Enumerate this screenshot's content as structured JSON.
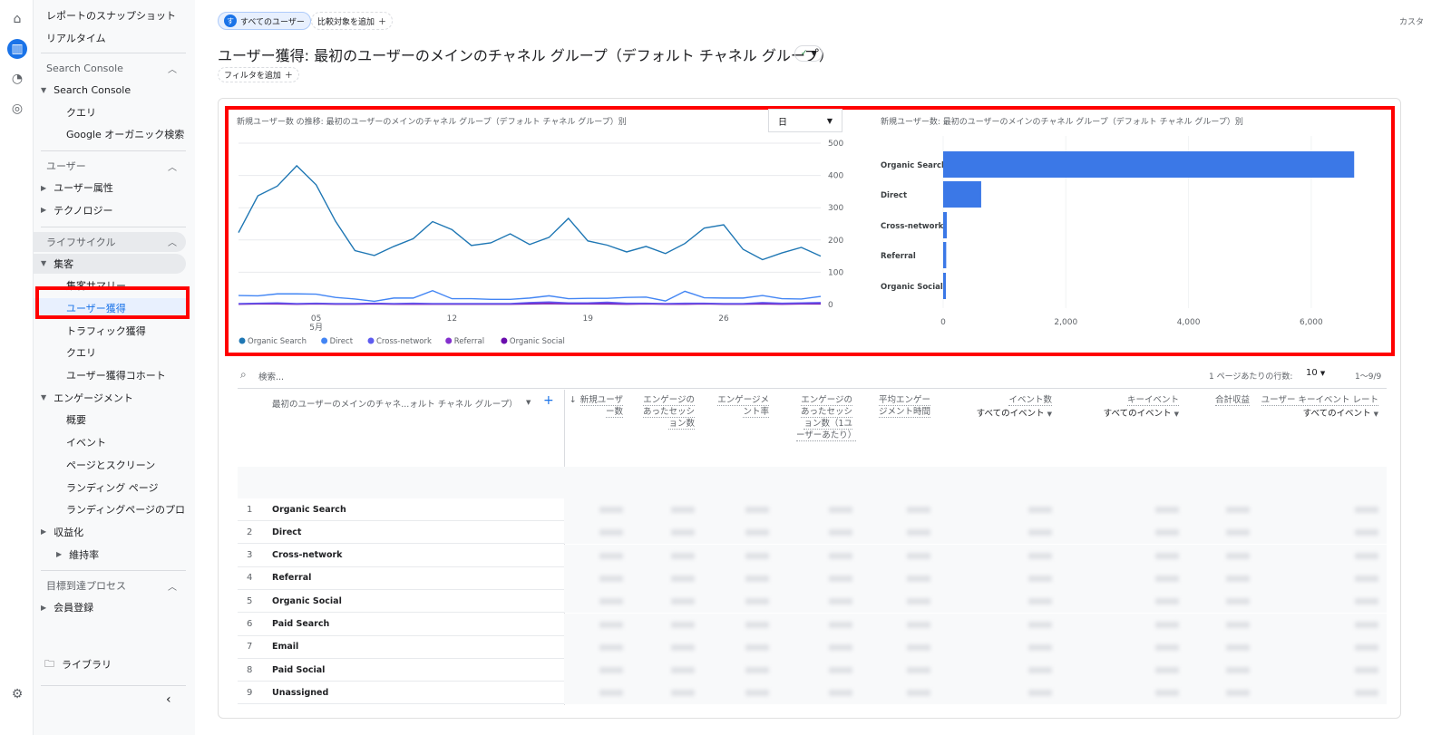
{
  "rail": {
    "icons": [
      "home-icon",
      "reports-icon",
      "explore-icon",
      "advertising-icon",
      "gear-icon"
    ]
  },
  "sidebar": {
    "top": [
      "レポートのスナップショット",
      "リアルタイム"
    ],
    "sections": [
      {
        "title": "Search Console",
        "items": [
          {
            "label": "Search Console",
            "expanded": true
          },
          {
            "label": "クエリ"
          },
          {
            "label": "Google オーガニック検索レ..."
          }
        ]
      },
      {
        "title": "ユーザー",
        "items": [
          {
            "label": "ユーザー属性"
          },
          {
            "label": "テクノロジー"
          }
        ]
      },
      {
        "title": "ライフサイクル",
        "items": [
          {
            "label": "集客",
            "expanded": true
          },
          {
            "label": "集客サマリー"
          },
          {
            "label": "ユーザー獲得",
            "selected": true
          },
          {
            "label": "トラフィック獲得"
          },
          {
            "label": "クエリ"
          },
          {
            "label": "ユーザー獲得コホート"
          },
          {
            "label": "エンゲージメント",
            "expanded": true
          },
          {
            "label": "概要"
          },
          {
            "label": "イベント"
          },
          {
            "label": "ページとスクリーン"
          },
          {
            "label": "ランディング ページ"
          },
          {
            "label": "ランディングページのプロ..."
          },
          {
            "label": "収益化"
          },
          {
            "label": "維持率"
          }
        ]
      },
      {
        "title": "目標到達プロセス",
        "items": [
          {
            "label": "会員登録"
          }
        ]
      }
    ],
    "library": "ライブラリ"
  },
  "header": {
    "segment_avatar": "す",
    "segment": "すべてのユーザー",
    "add_comparison": "比較対象を追加",
    "title": "ユーザー獲得: 最初のユーザーのメインのチャネル グループ（デフォルト チャネル グループ）",
    "add_filter": "フィルタを追加",
    "customize": "カスタ"
  },
  "colors": {
    "accent": "#1a73e8",
    "highlight": "#ff0000"
  },
  "chart_data": [
    {
      "type": "line",
      "title": "新規ユーザー数 の推移: 最初のユーザーのメインのチャネル グループ（デフォルト チャネル グループ）別",
      "granularity": "日",
      "x_ticks": [
        "05",
        "12",
        "19",
        "26"
      ],
      "x_month": "5月",
      "y_ticks": [
        0,
        100,
        200,
        300,
        400,
        500
      ],
      "ylim": [
        0,
        500
      ],
      "grid": true,
      "legend": "bottom-left",
      "x": [
        "5/1",
        "5/2",
        "5/3",
        "5/4",
        "5/5",
        "5/6",
        "5/7",
        "5/8",
        "5/9",
        "5/10",
        "5/11",
        "5/12",
        "5/13",
        "5/14",
        "5/15",
        "5/16",
        "5/17",
        "5/18",
        "5/19",
        "5/20",
        "5/21",
        "5/22",
        "5/23",
        "5/24",
        "5/25",
        "5/26",
        "5/27",
        "5/28",
        "5/29",
        "5/30",
        "5/31"
      ],
      "series": [
        {
          "name": "Organic Search",
          "color": "#1f77b4",
          "values": [
            223,
            337,
            367,
            430,
            371,
            258,
            167,
            152,
            180,
            204,
            257,
            232,
            183,
            191,
            219,
            186,
            208,
            267,
            197,
            184,
            163,
            180,
            158,
            189,
            237,
            247,
            171,
            139,
            160,
            177,
            150
          ]
        },
        {
          "name": "Direct",
          "color": "#4285f4",
          "values": [
            28,
            27,
            33,
            33,
            32,
            22,
            17,
            10,
            20,
            20,
            43,
            18,
            18,
            16,
            16,
            20,
            27,
            18,
            19,
            19,
            22,
            23,
            11,
            41,
            21,
            20,
            20,
            28,
            18,
            17,
            25
          ]
        },
        {
          "name": "Cross-network",
          "color": "#5e5cf0",
          "values": [
            3,
            4,
            5,
            3,
            4,
            3,
            3,
            4,
            3,
            4,
            3,
            3,
            3,
            3,
            3,
            6,
            8,
            5,
            5,
            7,
            4,
            4,
            3,
            4,
            4,
            3,
            3,
            6,
            4,
            5,
            6
          ]
        },
        {
          "name": "Referral",
          "color": "#8430ce",
          "values": [
            2,
            3,
            3,
            2,
            3,
            2,
            2,
            3,
            2,
            2,
            2,
            2,
            2,
            2,
            2,
            4,
            6,
            3,
            3,
            4,
            2,
            3,
            2,
            2,
            3,
            2,
            2,
            4,
            2,
            3,
            4
          ]
        },
        {
          "name": "Organic Social",
          "color": "#6a0dad",
          "values": [
            1,
            2,
            2,
            1,
            2,
            1,
            1,
            2,
            1,
            1,
            1,
            1,
            1,
            1,
            1,
            2,
            3,
            2,
            2,
            2,
            1,
            2,
            1,
            1,
            2,
            1,
            1,
            2,
            1,
            2,
            2
          ]
        }
      ]
    },
    {
      "type": "bar",
      "orientation": "horizontal",
      "title": "新規ユーザー数: 最初のユーザーのメインのチャネル グループ（デフォルト チャネル グループ）別",
      "categories": [
        "Organic Search",
        "Direct",
        "Cross-network",
        "Referral",
        "Organic Social"
      ],
      "values": [
        6700,
        620,
        60,
        50,
        45
      ],
      "x_ticks": [
        0,
        2000,
        4000,
        6000
      ],
      "xlim": [
        0,
        6800
      ],
      "color": "#3b78e7"
    }
  ],
  "table": {
    "search_placeholder": "検索...",
    "rows_per_page_label": "1 ページあたりの行数:",
    "rows_per_page": "10",
    "range": "1～9/9",
    "dimension_header": "最初のユーザーのメインのチャネ...ォルト チャネル グループ）",
    "columns": [
      {
        "label": "新規ユーザー数",
        "sorted": true
      },
      {
        "label": "エンゲージのあったセッション数"
      },
      {
        "label": "エンゲージメント率"
      },
      {
        "label": "エンゲージのあったセッション数（1ユーザーあたり）"
      },
      {
        "label": "平均エンゲージメント時間"
      },
      {
        "label": "イベント数",
        "sub": "すべてのイベント"
      },
      {
        "label": "キーイベント",
        "sub": "すべてのイベント"
      },
      {
        "label": "合計収益"
      },
      {
        "label": "ユーザー キーイベント レート",
        "sub": "すべてのイベント"
      }
    ],
    "rows": [
      {
        "n": "1",
        "name": "Organic Search"
      },
      {
        "n": "2",
        "name": "Direct"
      },
      {
        "n": "3",
        "name": "Cross-network"
      },
      {
        "n": "4",
        "name": "Referral"
      },
      {
        "n": "5",
        "name": "Organic Social"
      },
      {
        "n": "6",
        "name": "Paid Search"
      },
      {
        "n": "7",
        "name": "Email"
      },
      {
        "n": "8",
        "name": "Paid Social"
      },
      {
        "n": "9",
        "name": "Unassigned"
      }
    ]
  }
}
